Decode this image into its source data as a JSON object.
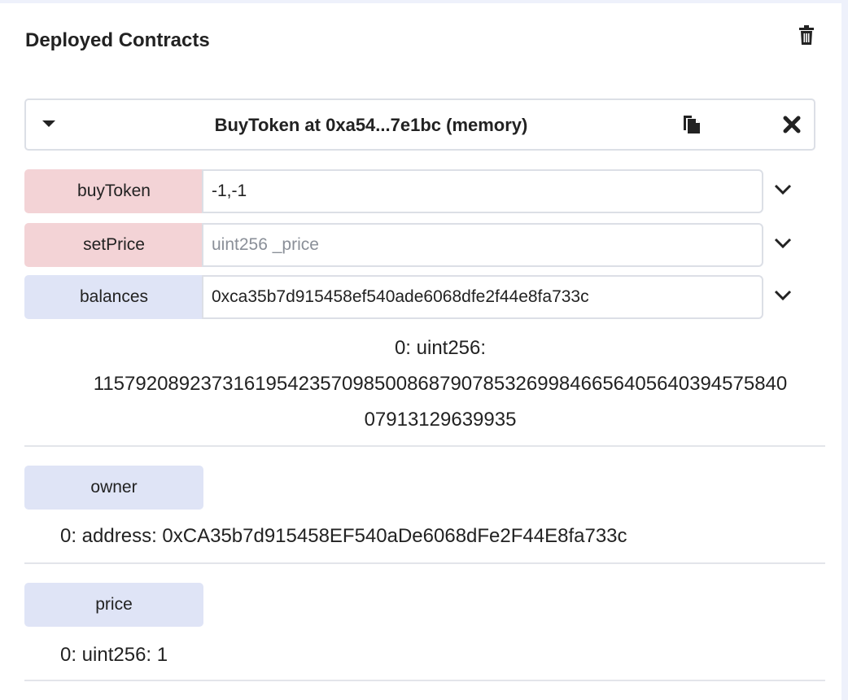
{
  "panel": {
    "title": "Deployed Contracts"
  },
  "instance": {
    "title": "BuyToken at 0xa54...7e1bc (memory)"
  },
  "functions": {
    "buyToken": {
      "label": "buyToken",
      "value": "-1,-1",
      "placeholder": ""
    },
    "setPrice": {
      "label": "setPrice",
      "value": "",
      "placeholder": "uint256 _price"
    },
    "balances": {
      "label": "balances",
      "value": "0xca35b7d915458ef540ade6068dfe2f44e8fa733c",
      "placeholder": ""
    }
  },
  "balances_result": {
    "line1": "0: uint256:",
    "line2": "115792089237316195423570985008687907853269984665640564039457584 0",
    "line2_exact": "1157920892373161954235709850086879078532699846656405640394575840",
    "line3": "07913129639935"
  },
  "owner": {
    "label": "owner",
    "result": "0: address: 0xCA35b7d915458EF540aDe6068dFe2F44E8fa733c"
  },
  "price": {
    "label": "price",
    "result": "0: uint256: 1"
  },
  "colors": {
    "transact_button": "#f3d3d6",
    "call_button": "#dfe4f6",
    "border": "#dcdfe6"
  },
  "icons": {
    "clear": "trash-icon",
    "copy": "copy-icon",
    "remove": "close-icon",
    "toggle": "caret-down-icon",
    "expand": "chevron-down-icon"
  }
}
